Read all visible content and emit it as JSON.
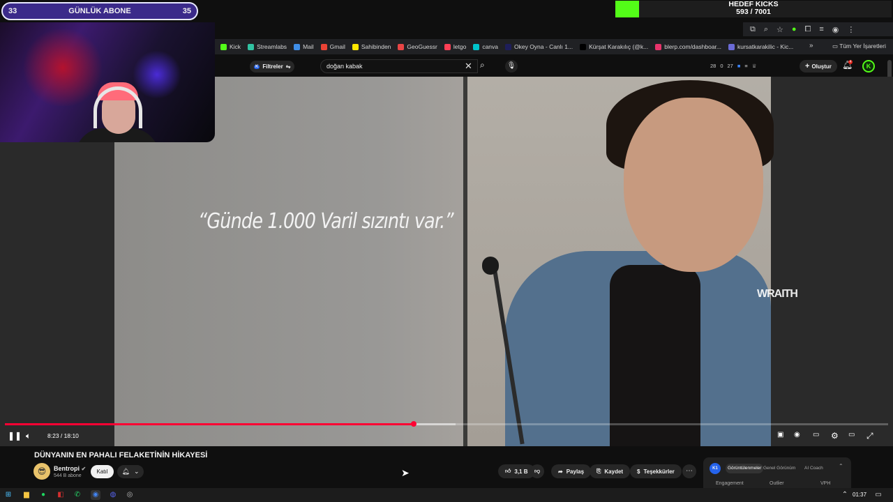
{
  "overlay": {
    "sub_goal_left": "33",
    "sub_goal_title": "GÜNLÜK ABONE",
    "sub_goal_right": "35",
    "kick_goal_title": "HEDEF KICKS",
    "kick_goal_value": "593 / 7001",
    "kick_goal_progress": 0.085
  },
  "bookmarks": [
    {
      "label": "Kick",
      "color": "#53fc18"
    },
    {
      "label": "Streamlabs",
      "color": "#31c3a2"
    },
    {
      "label": "Mail",
      "color": "#3f8ee8"
    },
    {
      "label": "Gmail",
      "color": "#ea4335"
    },
    {
      "label": "Sahibinden",
      "color": "#ffe800"
    },
    {
      "label": "GeoGuessr",
      "color": "#e84545"
    },
    {
      "label": "letgo",
      "color": "#ff3f55"
    },
    {
      "label": "canva",
      "color": "#00c4cc"
    },
    {
      "label": "Okey Oyna - Canlı 1...",
      "color": "#1e1e5a"
    },
    {
      "label": "Kürşat Karakılıç (@k...",
      "color": "#000000"
    },
    {
      "label": "blerp.com/dashboar...",
      "color": "#e8336b"
    },
    {
      "label": "kursatkarakilic - Kic...",
      "color": "#6b6bd6"
    }
  ],
  "bookmarks_all": "Tüm Yer İşaretleri",
  "youtube": {
    "filter_label": "Filtreler",
    "search_value": "doğan kabak",
    "stats": [
      "28",
      "0",
      "27"
    ],
    "create_label": "Oluştur",
    "notif_count": "4",
    "avatar_letter": "K"
  },
  "video": {
    "quote": "“Günde 1.000 Varil sızıntı var.”",
    "corner_text": "WRAITH",
    "time": "8:23 / 18:10",
    "progress": 0.463,
    "buffered": 0.51
  },
  "meta": {
    "title": "DÜNYANIN EN PAHALI FELAKETİNİN HİKAYESİ",
    "channel": "Bentropi",
    "subs": "544 B abone",
    "join": "Katıl",
    "likes": "3,1 B",
    "share": "Paylaş",
    "save": "Kaydet",
    "thanks": "Teşekkürler"
  },
  "panel": {
    "logo": "K1",
    "tabs": [
      "Görüntülenmeler",
      "Genel Görünüm",
      "AI Coach"
    ],
    "columns": [
      "Engagement",
      "Outlier",
      "VPH"
    ]
  },
  "taskbar": {
    "clock": "01:37"
  }
}
